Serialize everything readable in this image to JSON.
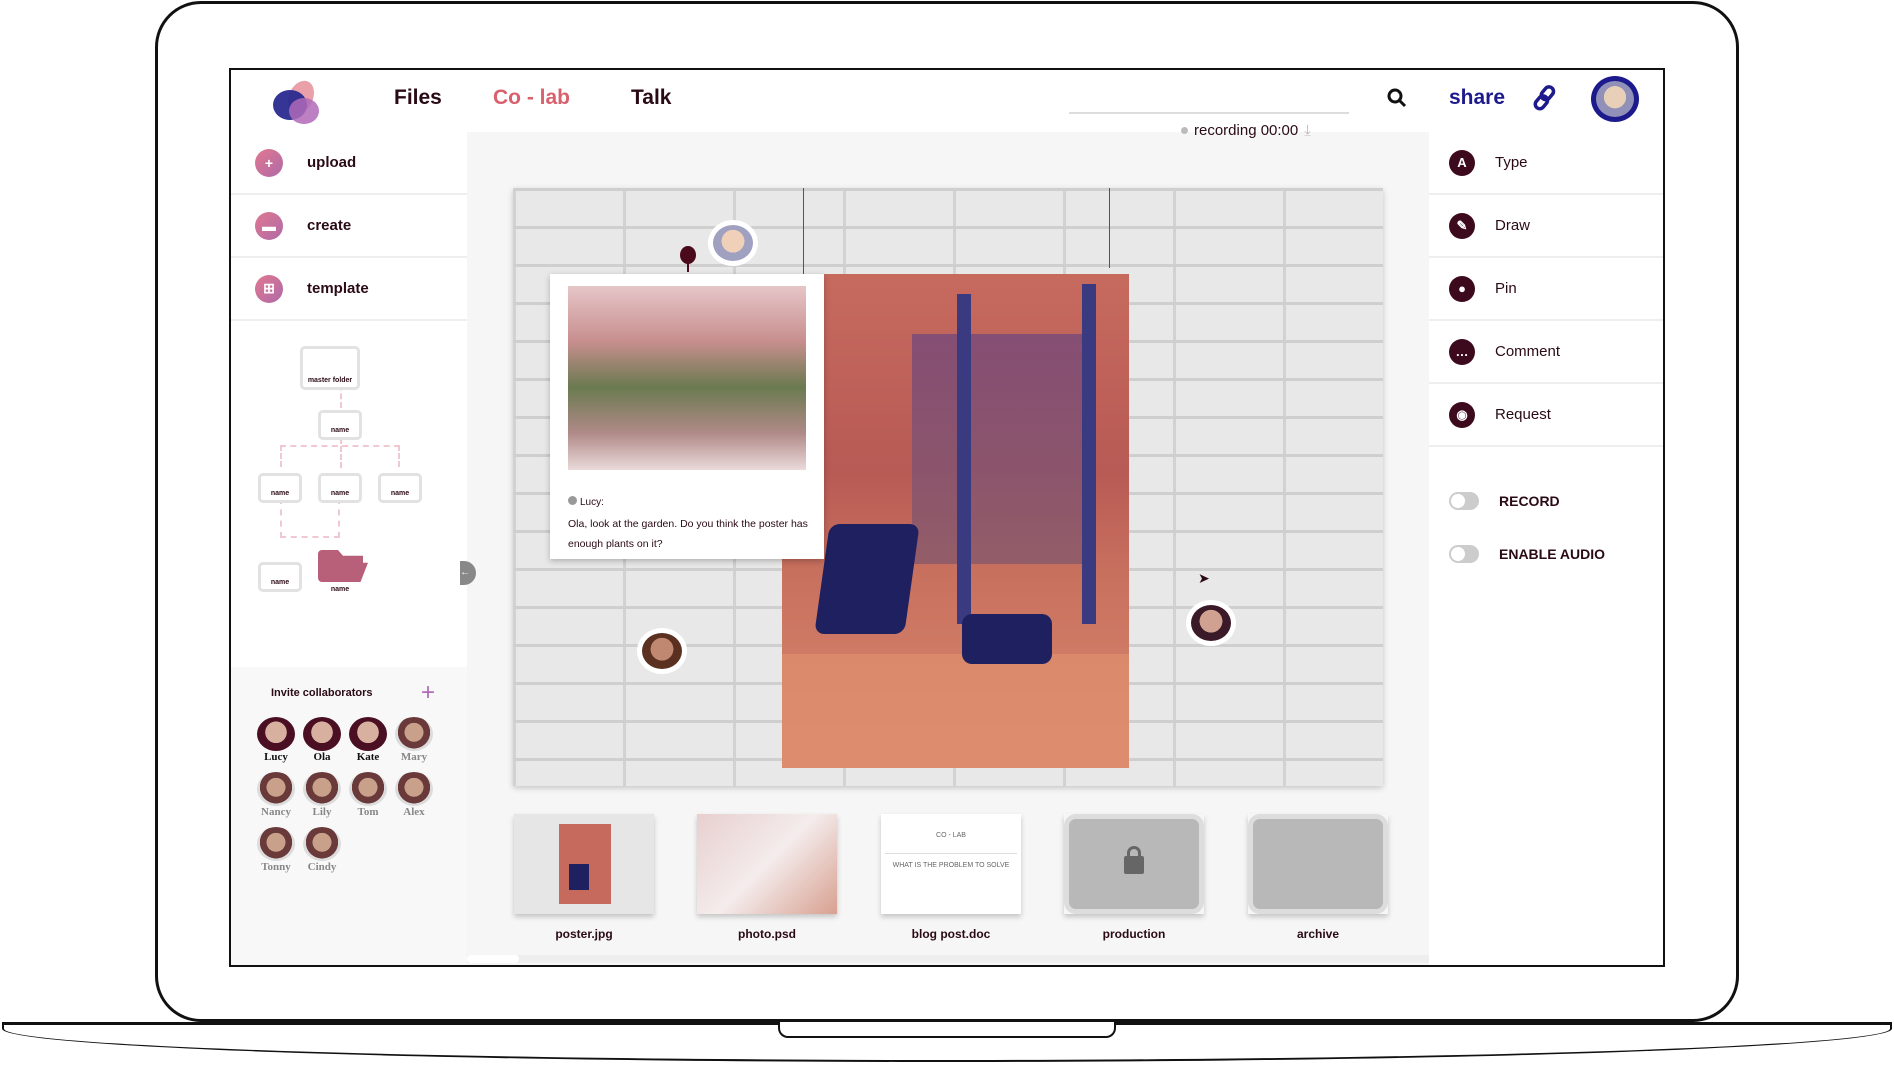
{
  "header": {
    "nav": [
      "Files",
      "Co - lab",
      "Talk"
    ],
    "active_nav": "Co - lab",
    "share": "share",
    "search_placeholder": ""
  },
  "sidebar": {
    "actions": [
      {
        "label": "upload",
        "icon": "plus-icon"
      },
      {
        "label": "create",
        "icon": "folder-icon"
      },
      {
        "label": "template",
        "icon": "sitemap-icon"
      }
    ],
    "tree": {
      "root": "master folder",
      "node": "name",
      "children": [
        "name",
        "name",
        "name"
      ],
      "leaves": [
        "name",
        "name"
      ]
    },
    "invite_label": "Invite collaborators",
    "collaborators": [
      {
        "name": "Lucy",
        "active": true
      },
      {
        "name": "Ola",
        "active": true
      },
      {
        "name": "Kate",
        "active": true
      },
      {
        "name": "Mary",
        "active": false
      },
      {
        "name": "Nancy",
        "active": false
      },
      {
        "name": "Lily",
        "active": false
      },
      {
        "name": "Tom",
        "active": false
      },
      {
        "name": "Alex",
        "active": false
      },
      {
        "name": "Tonny",
        "active": false
      },
      {
        "name": "Cindy",
        "active": false
      }
    ]
  },
  "canvas": {
    "recording": "recording 00:00",
    "comment": {
      "author": "Lucy:",
      "text": "Ola, look at the garden. Do you think the poster has enough plants on it?"
    }
  },
  "files": [
    {
      "label": "poster.jpg",
      "type": "image"
    },
    {
      "label": "photo.psd",
      "type": "image"
    },
    {
      "label": "blog post.doc",
      "type": "doc",
      "doc_title": "CO - LAB",
      "doc_heading": "WHAT IS THE PROBLEM TO SOLVE"
    },
    {
      "label": "production",
      "type": "folder",
      "locked": true
    },
    {
      "label": "archive",
      "type": "folder",
      "locked": false
    }
  ],
  "tools": [
    {
      "label": "Type",
      "icon": "type-icon"
    },
    {
      "label": "Draw",
      "icon": "pencil-icon"
    },
    {
      "label": "Pin",
      "icon": "pin-icon"
    },
    {
      "label": "Comment",
      "icon": "comment-icon"
    },
    {
      "label": "Request",
      "icon": "request-icon"
    }
  ],
  "toggles": [
    {
      "label": "RECORD",
      "on": false
    },
    {
      "label": "ENABLE AUDIO",
      "on": false
    }
  ],
  "colors": {
    "accent": "#d9616e",
    "brand_dark": "#3c0a1c",
    "link": "#1c1a8c"
  }
}
